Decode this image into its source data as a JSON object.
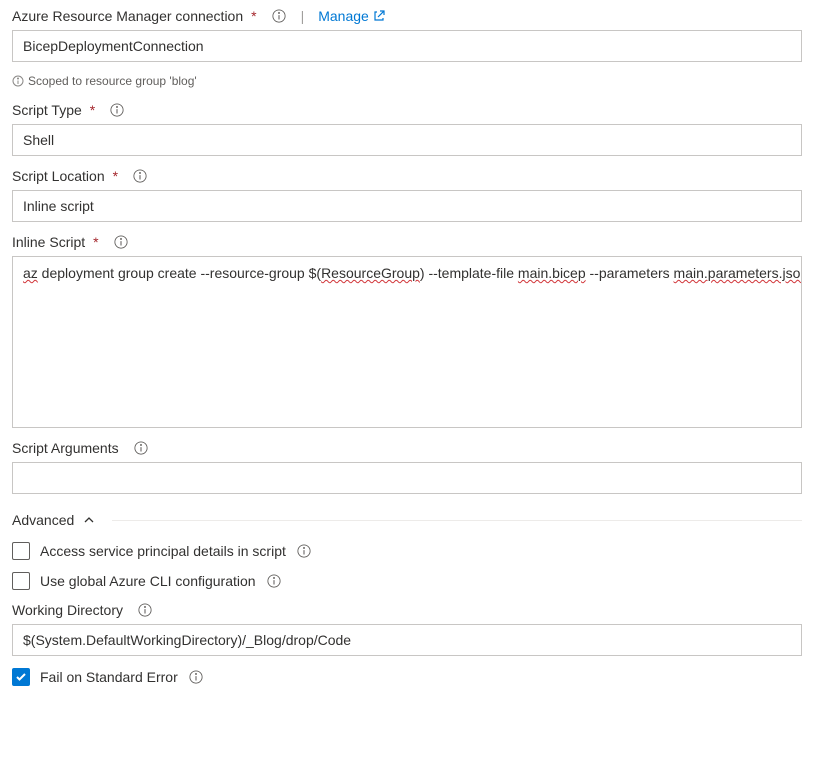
{
  "connection": {
    "label": "Azure Resource Manager connection",
    "value": "BicepDeploymentConnection",
    "manage_label": "Manage",
    "scope_hint": "Scoped to resource group 'blog'"
  },
  "script_type": {
    "label": "Script Type",
    "value": "Shell"
  },
  "script_location": {
    "label": "Script Location",
    "value": "Inline script"
  },
  "inline_script": {
    "label": "Inline Script",
    "value": "az deployment group create --resource-group $(ResourceGroup) --template-file main.bicep --parameters main.parameters.json",
    "parts": {
      "p1": "az",
      "p2": " deployment group create --resource-group $(",
      "p3": "ResourceGroup",
      "p4": ") --template-file ",
      "p5": "main.bicep",
      "p6": " --parameters ",
      "p7": "main.parameters.json"
    }
  },
  "script_arguments": {
    "label": "Script Arguments",
    "value": ""
  },
  "advanced": {
    "section_title": "Advanced",
    "access_principal": {
      "label": "Access service principal details in script",
      "checked": false
    },
    "global_cli": {
      "label": "Use global Azure CLI configuration",
      "checked": false
    },
    "working_directory": {
      "label": "Working Directory",
      "value": "$(System.DefaultWorkingDirectory)/_Blog/drop/Code"
    },
    "fail_on_error": {
      "label": "Fail on Standard Error",
      "checked": true
    }
  }
}
